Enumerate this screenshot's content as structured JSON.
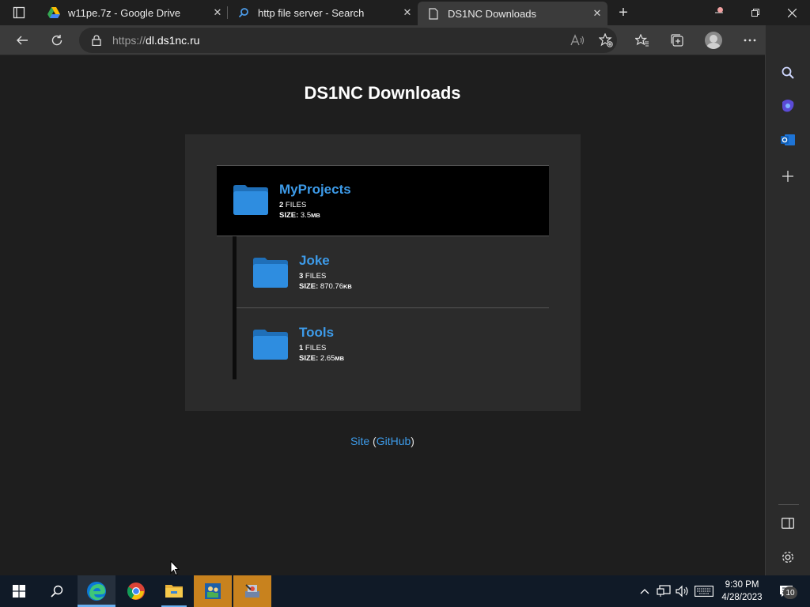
{
  "browser": {
    "tabs": [
      {
        "title": "w11pe.7z - Google Drive",
        "icon": "google-drive-icon"
      },
      {
        "title": "http file server - Search",
        "icon": "search-icon"
      },
      {
        "title": "DS1NC Downloads",
        "icon": "page-icon",
        "active": true
      }
    ],
    "address": {
      "scheme": "https://",
      "host": "dl.ds1nc.ru"
    }
  },
  "page": {
    "title": "DS1NC Downloads",
    "folders": [
      {
        "name": "MyProjects",
        "files_count": "2",
        "files_label": " FILES",
        "size_label": "SIZE:",
        "size_value": " 3.5",
        "size_unit": "MB"
      },
      {
        "name": "Joke",
        "files_count": "3",
        "files_label": " FILES",
        "size_label": "SIZE:",
        "size_value": " 870.76",
        "size_unit": "KB"
      },
      {
        "name": "Tools",
        "files_count": "1",
        "files_label": " FILES",
        "size_label": "SIZE:",
        "size_value": " 2.65",
        "size_unit": "MB"
      }
    ],
    "footer": {
      "site": "Site",
      "open_paren": " (",
      "github": "GitHub",
      "close_paren": ")"
    }
  },
  "taskbar": {
    "time": "9:30 PM",
    "date": "4/28/2023",
    "notification_count": "10"
  },
  "colors": {
    "accent": "#3d9be9",
    "folder": "#2e8de0",
    "folder_dark": "#1f6fb8",
    "active_tab": "#3b3b3b",
    "taskbar": "#101a27",
    "taskbar_orange": "#c8821e"
  }
}
